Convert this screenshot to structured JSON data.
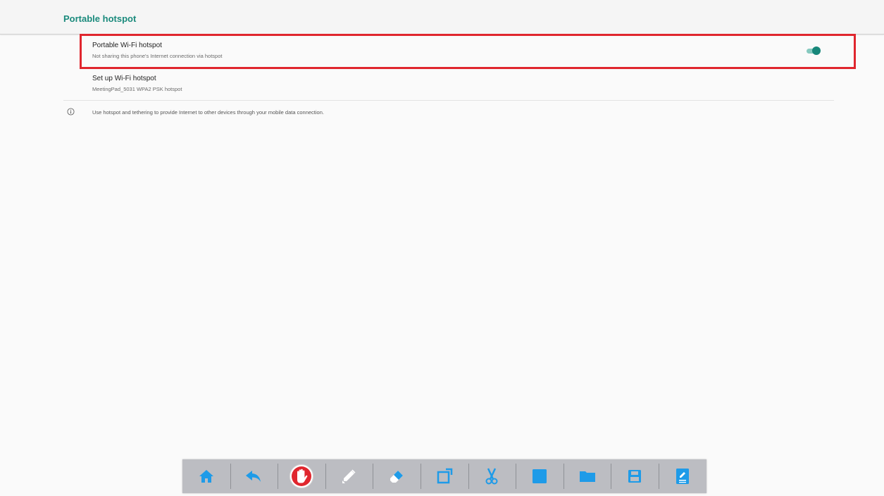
{
  "header": {
    "title": "Portable hotspot"
  },
  "preferences": {
    "hotspot": {
      "title": "Portable Wi-Fi hotspot",
      "summary": "Not sharing this phone's Internet connection via hotspot",
      "toggle_on": true
    },
    "setup": {
      "title": "Set up Wi-Fi hotspot",
      "summary": "MeetingPad_5031 WPA2 PSK hotspot"
    }
  },
  "info": {
    "icon": "info-icon",
    "text": "Use hotspot and tethering to provide Internet to other devices through your mobile data connection."
  },
  "toolbar": {
    "buttons": [
      {
        "icon": "home-icon"
      },
      {
        "icon": "undo-icon"
      },
      {
        "icon": "hand-icon"
      },
      {
        "icon": "pen-icon"
      },
      {
        "icon": "eraser-icon"
      },
      {
        "icon": "crop-icon"
      },
      {
        "icon": "scissors-icon"
      },
      {
        "icon": "whiteboard-icon"
      },
      {
        "icon": "folder-icon"
      },
      {
        "icon": "save-icon"
      },
      {
        "icon": "note-icon"
      }
    ]
  },
  "colors": {
    "accent": "#1a8a7c",
    "highlight": "#e0262e",
    "toolbar_icon": "#1e9be8",
    "toolbar_bg": "#bcbdc2"
  }
}
